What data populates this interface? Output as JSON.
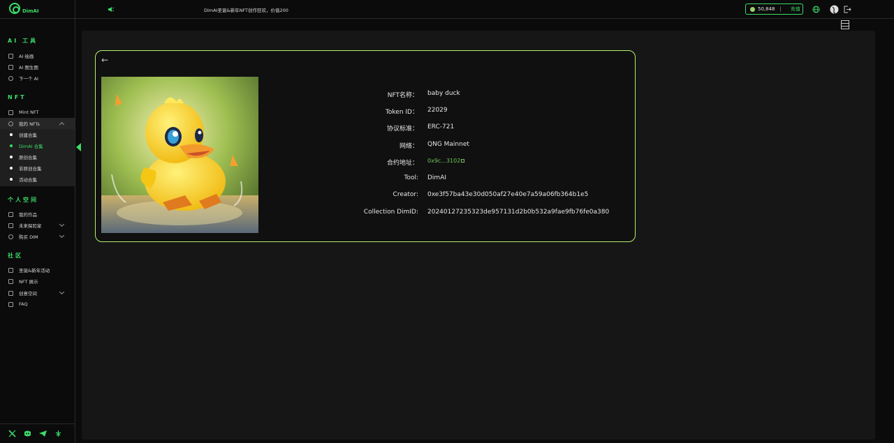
{
  "header": {
    "logo_text": "DimAI",
    "announcement": "DimAI圣诞&新年NFT创作狂欢，价值200",
    "balance": "50,848",
    "separator": "|",
    "recharge_label": "充值"
  },
  "sidebar": {
    "sections": [
      {
        "title": "AI 工具",
        "items": [
          "AI 绘画",
          "AI 图生图",
          "下一个 AI"
        ]
      },
      {
        "title": "NFT",
        "items": [
          "Mint NFT",
          "我的 NFTs"
        ]
      },
      {
        "title": "个人空间",
        "items": [
          "我的作品",
          "未来探险家",
          "购买 DIM"
        ]
      },
      {
        "title": "社区",
        "items": [
          "圣诞&新年活动",
          "NFT 展示",
          "创意空间",
          "FAQ"
        ]
      }
    ],
    "nft_subitems": [
      "创建合集",
      "DimAI 合集",
      "原创合集",
      "非原创合集",
      "活动合集"
    ]
  },
  "nft": {
    "image_alt": "baby duck",
    "fields": [
      {
        "label": "NFT名称：",
        "value": "baby duck"
      },
      {
        "label": "Token ID：",
        "value": "22029"
      },
      {
        "label": "协议标准：",
        "value": "ERC-721"
      },
      {
        "label": "网络：",
        "value": "QNG Mainnet"
      },
      {
        "label": "合约地址：",
        "value": "0x9c...3102"
      },
      {
        "label": "Tool:",
        "value": "DimAI"
      },
      {
        "label": "Creator:",
        "value": "0xe3f57ba43e30d050af27e40e7a59a06fb364b1e5"
      },
      {
        "label": "Collection DimID:",
        "value": "20240127235323de957131d2b0b532a9fae9fb76fe0a380"
      }
    ]
  },
  "colors": {
    "accent": "#3ddc6a",
    "card_border": "#b6f06a",
    "link": "#6fc35a"
  },
  "icons": [
    "announcement-icon",
    "coin-icon",
    "globe-icon",
    "avatar-icon",
    "logout-icon",
    "back-arrow-icon",
    "grid-toggle-icon",
    "x-icon",
    "discord-icon",
    "telegram-icon",
    "community-icon"
  ]
}
